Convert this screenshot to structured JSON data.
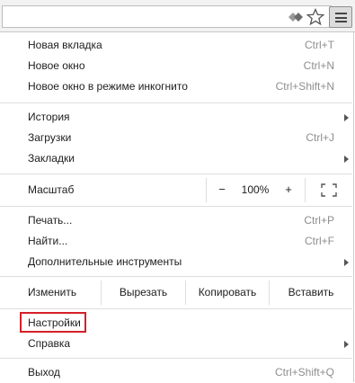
{
  "toolbar": {
    "omnibox_value": "",
    "icons": [
      "extension-diamond-icon",
      "bookmark-star-icon",
      "hamburger-menu-icon"
    ]
  },
  "menu": {
    "group1": [
      {
        "label": "Новая вкладка",
        "shortcut": "Ctrl+T"
      },
      {
        "label": "Новое окно",
        "shortcut": "Ctrl+N"
      },
      {
        "label": "Новое окно в режиме инкогнито",
        "shortcut": "Ctrl+Shift+N"
      }
    ],
    "group2": [
      {
        "label": "История",
        "shortcut": "",
        "submenu": true
      },
      {
        "label": "Загрузки",
        "shortcut": "Ctrl+J"
      },
      {
        "label": "Закладки",
        "shortcut": "",
        "submenu": true
      }
    ],
    "zoom": {
      "label": "Масштаб",
      "minus": "−",
      "value": "100%",
      "plus": "+"
    },
    "group3": [
      {
        "label": "Печать...",
        "shortcut": "Ctrl+P"
      },
      {
        "label": "Найти...",
        "shortcut": "Ctrl+F"
      },
      {
        "label": "Дополнительные инструменты",
        "shortcut": "",
        "submenu": true
      }
    ],
    "edit": {
      "label": "Изменить",
      "cut": "Вырезать",
      "copy": "Копировать",
      "paste": "Вставить"
    },
    "group4": [
      {
        "label": "Настройки",
        "shortcut": "",
        "highlighted": true
      },
      {
        "label": "Справка",
        "shortcut": "",
        "submenu": true
      }
    ],
    "exit": {
      "label": "Выход",
      "shortcut": "Ctrl+Shift+Q"
    }
  },
  "colors": {
    "highlight_border": "#d4202a",
    "shortcut_text": "#8e8e8e"
  }
}
